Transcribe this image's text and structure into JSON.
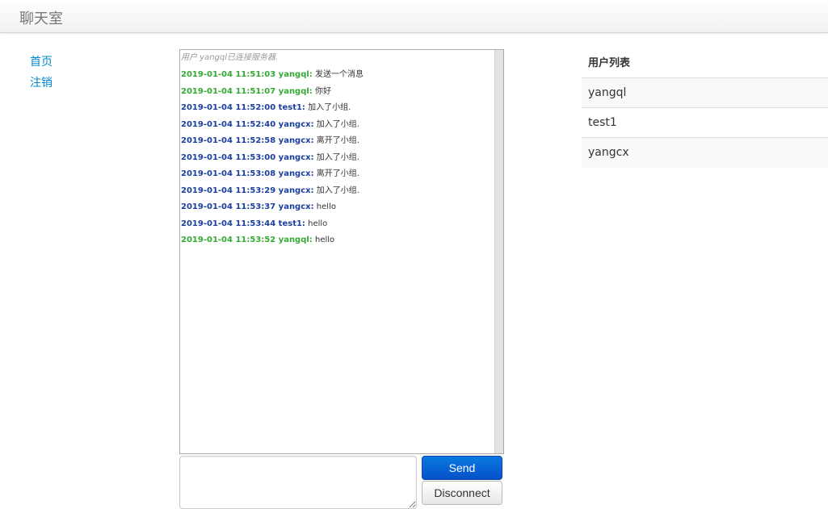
{
  "app": {
    "title": "聊天室"
  },
  "leftnav": {
    "items": [
      {
        "label": "首页"
      },
      {
        "label": "注销"
      }
    ]
  },
  "chat": {
    "system_message": "用户 yangql已连接服务器.",
    "messages": [
      {
        "meta": "2019-01-04 11:51:03 yangql:",
        "text": "发送一个消息",
        "kind": "self"
      },
      {
        "meta": "2019-01-04 11:51:07 yangql:",
        "text": "你好",
        "kind": "self"
      },
      {
        "meta": "2019-01-04 11:52:00 test1:",
        "text": "加入了小组.",
        "kind": "other"
      },
      {
        "meta": "2019-01-04 11:52:40 yangcx:",
        "text": "加入了小组.",
        "kind": "other"
      },
      {
        "meta": "2019-01-04 11:52:58 yangcx:",
        "text": "离开了小组.",
        "kind": "other"
      },
      {
        "meta": "2019-01-04 11:53:00 yangcx:",
        "text": "加入了小组.",
        "kind": "other"
      },
      {
        "meta": "2019-01-04 11:53:08 yangcx:",
        "text": "离开了小组.",
        "kind": "other"
      },
      {
        "meta": "2019-01-04 11:53:29 yangcx:",
        "text": "加入了小组.",
        "kind": "other"
      },
      {
        "meta": "2019-01-04 11:53:37 yangcx:",
        "text": "hello",
        "kind": "other"
      },
      {
        "meta": "2019-01-04 11:53:44 test1:",
        "text": "hello",
        "kind": "other"
      },
      {
        "meta": "2019-01-04 11:53:52 yangql:",
        "text": "hello",
        "kind": "self"
      }
    ],
    "colors": {
      "self": "#33aa33",
      "other": "#1a3f9e"
    }
  },
  "composer": {
    "value": "",
    "send_label": "Send",
    "disconnect_label": "Disconnect"
  },
  "users": {
    "header": "用户列表",
    "list": [
      {
        "name": "yangql"
      },
      {
        "name": "test1"
      },
      {
        "name": "yangcx"
      }
    ]
  }
}
